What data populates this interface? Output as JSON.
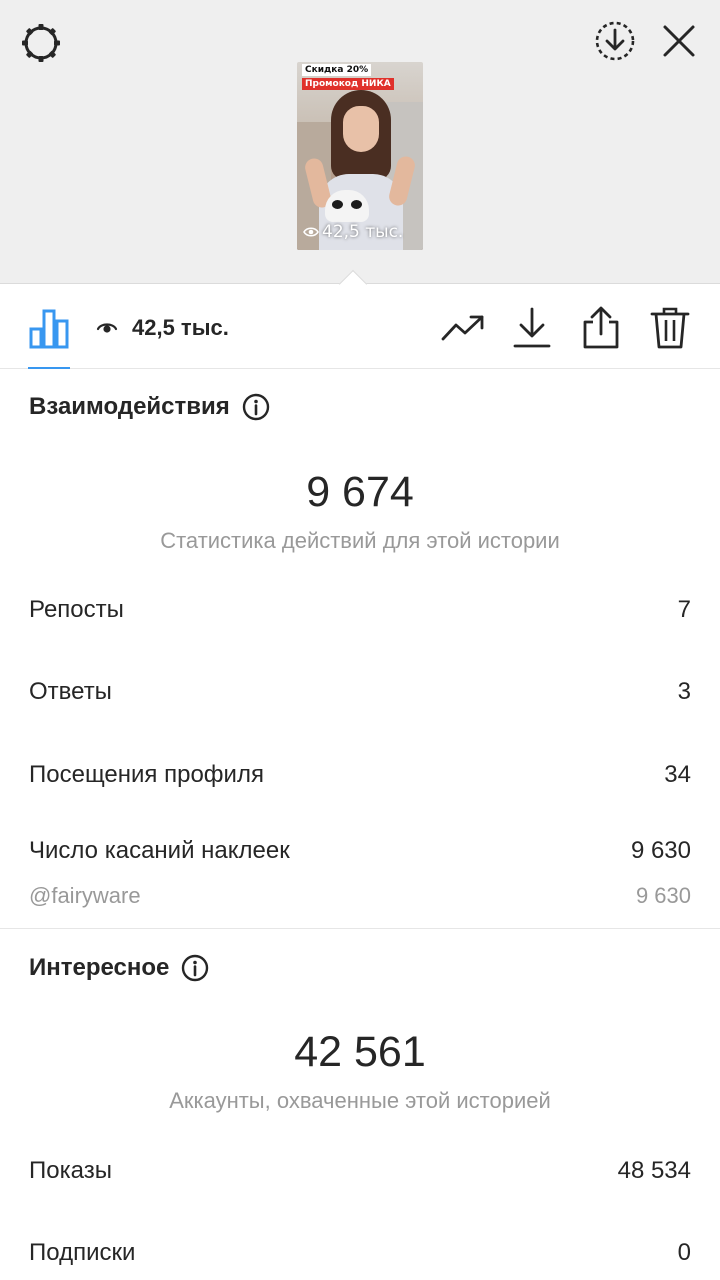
{
  "header": {
    "settings_icon": "settings-icon",
    "save_icon": "download-circle-icon",
    "close_icon": "close-icon"
  },
  "preview": {
    "sticker_discount": "Скидка 20%",
    "sticker_promo": "Промокод НИКА",
    "views_overlay": "42,5 тыс."
  },
  "toolbar": {
    "views": "42,5 тыс.",
    "accent_color": "#3897f0",
    "icons": [
      "bar-chart-icon",
      "eye-icon",
      "trending-up-icon",
      "download-icon",
      "share-icon",
      "trash-icon"
    ]
  },
  "interactions": {
    "title": "Взаимодействия",
    "total": "9 674",
    "caption": "Статистика действий для этой истории",
    "rows": [
      {
        "label": "Репосты",
        "value": "7"
      },
      {
        "label": "Ответы",
        "value": "3"
      },
      {
        "label": "Посещения профиля",
        "value": "34"
      },
      {
        "label": "Число касаний наклеек",
        "value": "9 630"
      }
    ],
    "sub_row": {
      "label": "@fairyware",
      "value": "9 630"
    }
  },
  "discovery": {
    "title": "Интересное",
    "total": "42 561",
    "caption": "Аккаунты, охваченные этой историей",
    "rows": [
      {
        "label": "Показы",
        "value": "48 534"
      },
      {
        "label": "Подписки",
        "value": "0"
      }
    ]
  }
}
